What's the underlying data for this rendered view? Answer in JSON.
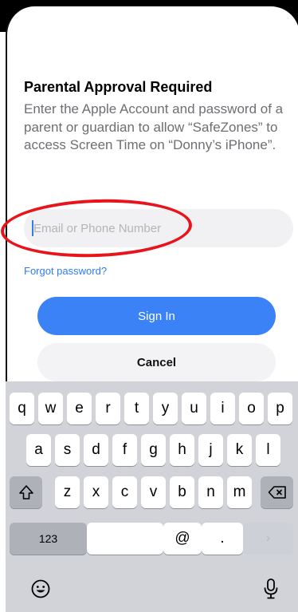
{
  "dialog": {
    "title": "Parental Approval Required",
    "message": "Enter the Apple Account and password of a parent or guardian to allow “SafeZones” to access Screen Time on “Donny’s iPhone”.",
    "email_placeholder": "Email or Phone Number",
    "forgot_link": "Forgot password?",
    "sign_in_label": "Sign In",
    "cancel_label": "Cancel"
  },
  "keyboard": {
    "row1": [
      "q",
      "w",
      "e",
      "r",
      "t",
      "y",
      "u",
      "i",
      "o",
      "p"
    ],
    "row2": [
      "a",
      "s",
      "d",
      "f",
      "g",
      "h",
      "j",
      "k",
      "l"
    ],
    "row3": [
      "z",
      "x",
      "c",
      "v",
      "b",
      "n",
      "m"
    ],
    "numbers_key": "123",
    "at_key": "@",
    "dot_key": ".",
    "icons": {
      "shift": "shift-icon",
      "delete": "delete-icon",
      "emoji": "emoji-icon",
      "mic": "microphone-icon",
      "return": "return-icon"
    }
  },
  "colors": {
    "accent": "#3b82f6",
    "annotation_circle": "#e8141b",
    "keyboard_background": "#d1d3d9"
  }
}
